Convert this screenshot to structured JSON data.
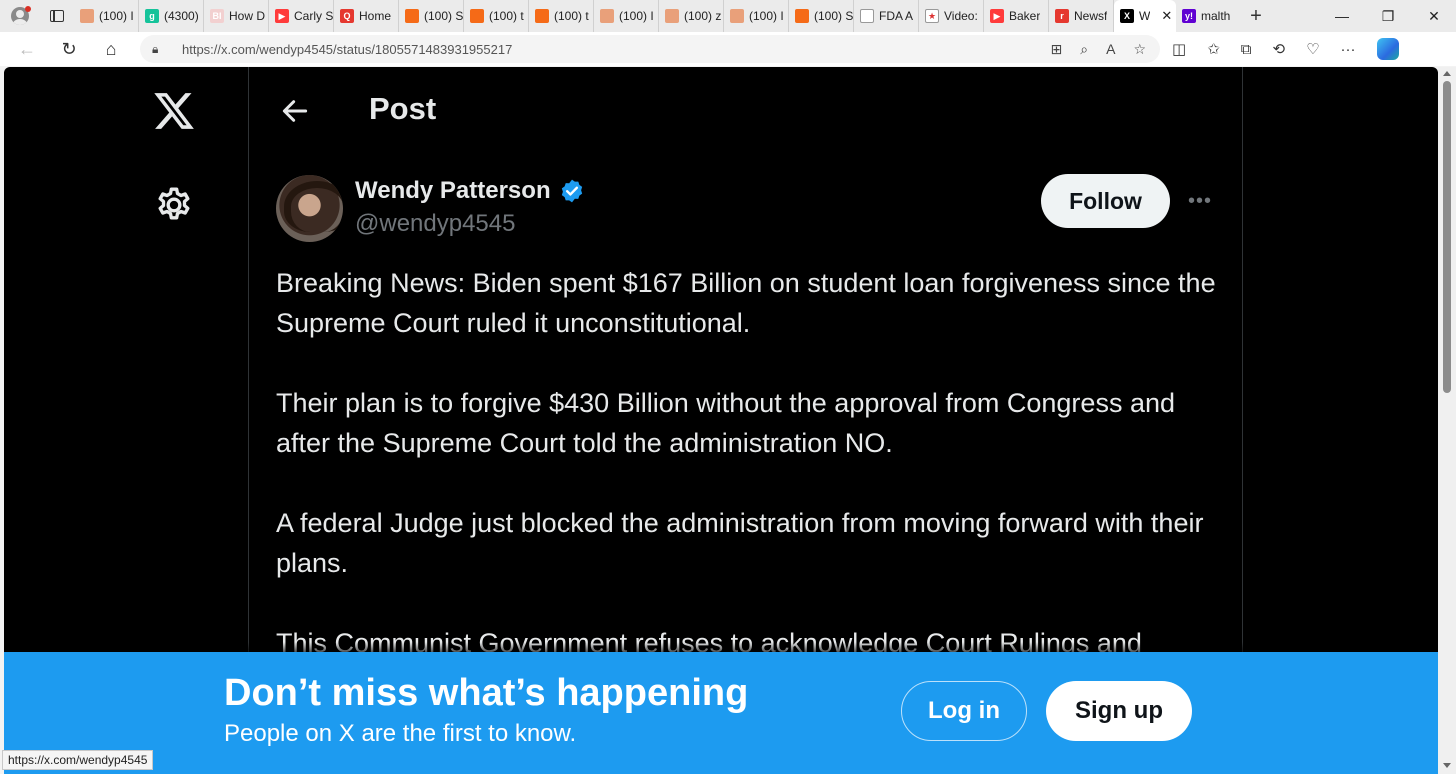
{
  "browser": {
    "tabs": [
      {
        "label": "(100) I",
        "fav_bg": "#e9a07a",
        "fav_text": ""
      },
      {
        "label": "(4300)",
        "fav_bg": "#15c39a",
        "fav_text": "g"
      },
      {
        "label": "How D",
        "fav_bg": "#f2d0d0",
        "fav_text": "BI"
      },
      {
        "label": "Carly S",
        "fav_bg": "#ff3b3b",
        "fav_text": "▶"
      },
      {
        "label": "Home",
        "fav_bg": "#e5382f",
        "fav_text": "Q"
      },
      {
        "label": "(100) S",
        "fav_bg": "#f56a17",
        "fav_text": ""
      },
      {
        "label": "(100) t",
        "fav_bg": "#f56a17",
        "fav_text": ""
      },
      {
        "label": "(100) t",
        "fav_bg": "#f56a17",
        "fav_text": ""
      },
      {
        "label": "(100) I",
        "fav_bg": "#e9a07a",
        "fav_text": ""
      },
      {
        "label": "(100) z",
        "fav_bg": "#e9a07a",
        "fav_text": ""
      },
      {
        "label": "(100) I",
        "fav_bg": "#e9a07a",
        "fav_text": ""
      },
      {
        "label": "(100) S",
        "fav_bg": "#f56a17",
        "fav_text": ""
      },
      {
        "label": "FDA A",
        "fav_bg": "#ffffff",
        "fav_text": ""
      },
      {
        "label": "Video:",
        "fav_bg": "#ffffff",
        "fav_text": "★"
      },
      {
        "label": "Baker",
        "fav_bg": "#ff3b3b",
        "fav_text": "▶"
      },
      {
        "label": "Newsf",
        "fav_bg": "#e5382f",
        "fav_text": "r"
      }
    ],
    "active_tab": {
      "label": "W",
      "fav_text": "X"
    },
    "last_tab": {
      "label": "malth",
      "fav_text": "y!"
    },
    "url": "https://x.com/wendyp4545/status/1805571483931955217",
    "status_url": "https://x.com/wendyp4545"
  },
  "page": {
    "title": "Post",
    "author_name": "Wendy Patterson",
    "author_handle": "@wendyp4545",
    "follow_label": "Follow",
    "more_label": "•••",
    "tweet_paragraphs": [
      "Breaking News: Biden spent $167 Billion on student loan forgiveness since the Supreme Court ruled it unconstitutional.",
      "Their plan is to forgive $430 Billion without the approval from Congress and after the Supreme Court told the administration NO.",
      "A federal Judge just blocked the administration from moving forward with their plans.",
      "This Communist Government refuses to acknowledge Court Rulings and"
    ]
  },
  "banner": {
    "title": "Don’t miss what’s happening",
    "subtitle": "People on X are the first to know.",
    "login_label": "Log in",
    "signup_label": "Sign up"
  },
  "colors": {
    "background": "#000000",
    "banner": "#1d9bf0",
    "verified": "#1d9bf0",
    "text_primary": "#e7e9ea",
    "text_secondary": "#71767b"
  }
}
